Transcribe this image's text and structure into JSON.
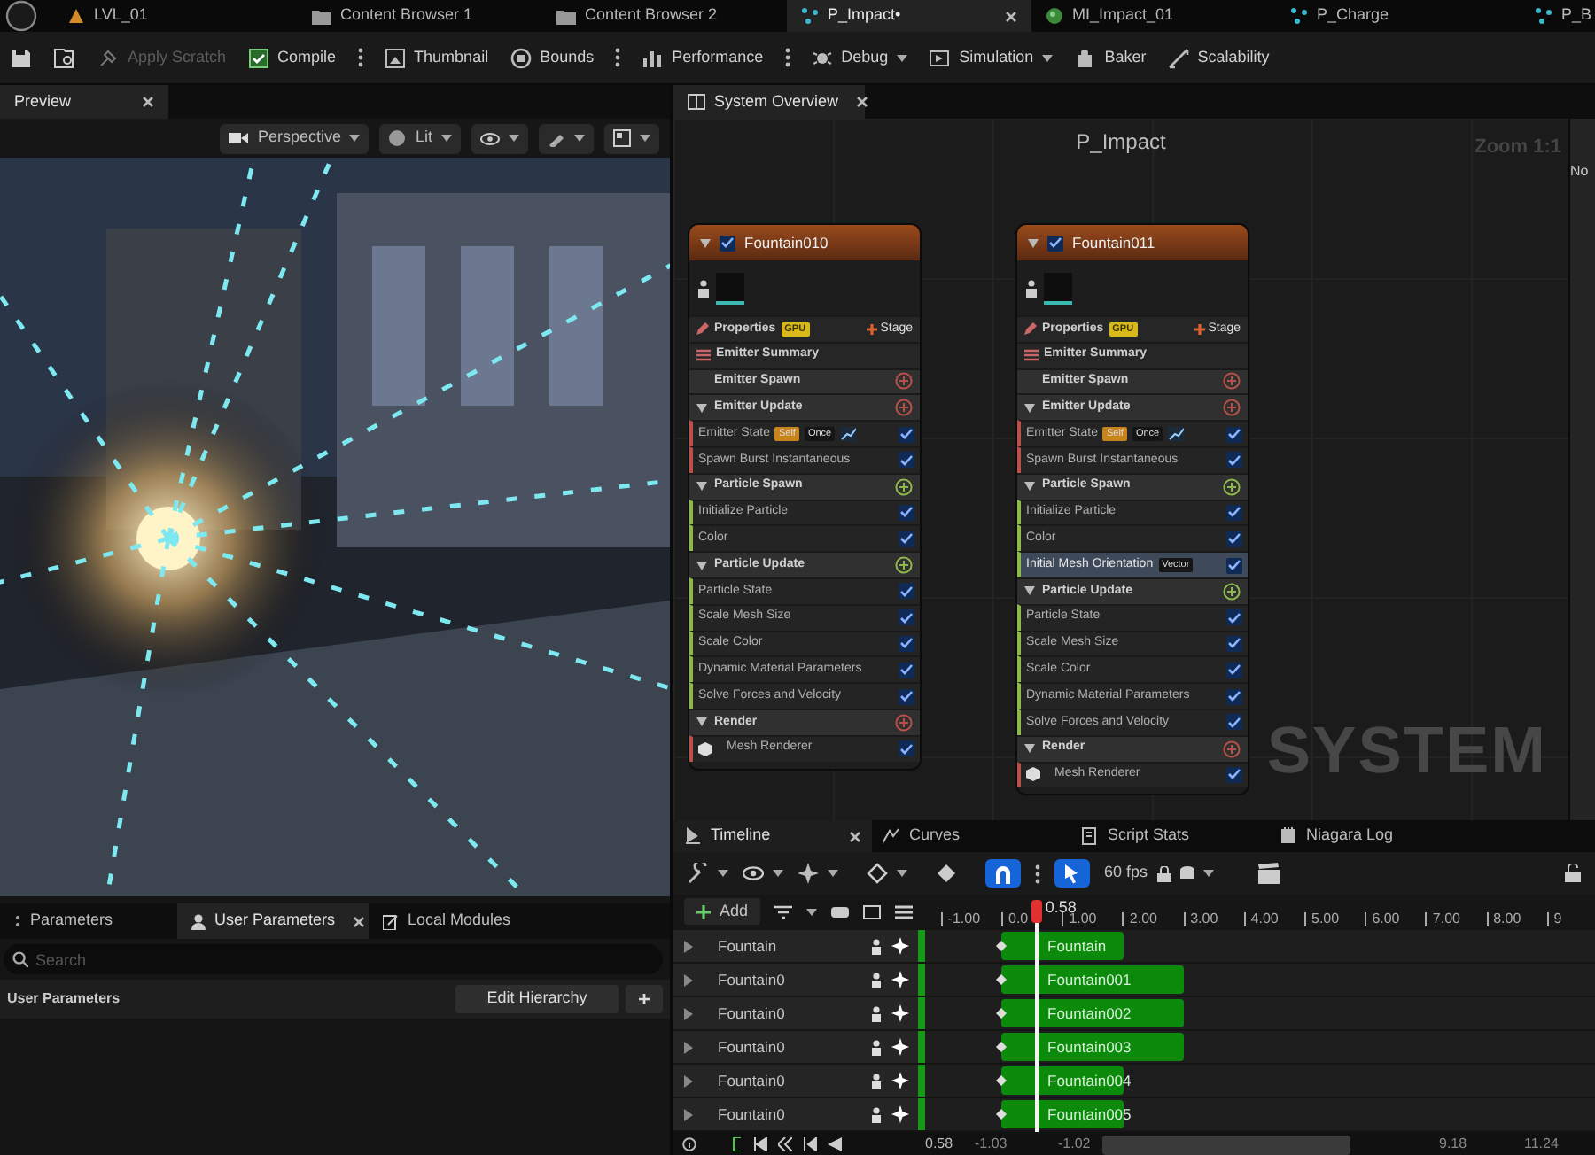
{
  "document_tabs": [
    {
      "label": "LVL_01",
      "selected": false
    },
    {
      "label": "Content Browser 1",
      "selected": false
    },
    {
      "label": "Content Browser 2",
      "selected": false
    },
    {
      "label": "P_Impact•",
      "selected": true
    },
    {
      "label": "MI_Impact_01",
      "selected": false
    },
    {
      "label": "P_Charge",
      "selected": false
    },
    {
      "label": "P_B",
      "selected": false
    }
  ],
  "toolbar": [
    {
      "label": "Apply Scratch",
      "disabled": true,
      "dropdown": false,
      "options": false
    },
    {
      "label": "Compile",
      "disabled": false,
      "dropdown": false,
      "options": true
    },
    {
      "label": "Thumbnail",
      "disabled": false,
      "dropdown": false,
      "options": false
    },
    {
      "label": "Bounds",
      "disabled": false,
      "dropdown": false,
      "options": true
    },
    {
      "label": "Performance",
      "disabled": false,
      "dropdown": false,
      "options": true
    },
    {
      "label": "Debug",
      "disabled": false,
      "dropdown": true,
      "options": false
    },
    {
      "label": "Simulation",
      "disabled": false,
      "dropdown": true,
      "options": false
    },
    {
      "label": "Baker",
      "disabled": false,
      "dropdown": false,
      "options": false
    },
    {
      "label": "Scalability",
      "disabled": false,
      "dropdown": false,
      "options": false
    }
  ],
  "preview": {
    "tab": "Preview",
    "view_mode": "Perspective",
    "lighting": "Lit"
  },
  "parameters": {
    "tabs": [
      {
        "label": "Parameters",
        "selected": false
      },
      {
        "label": "User Parameters",
        "selected": true
      },
      {
        "label": "Local Modules",
        "selected": false
      }
    ],
    "search": {
      "placeholder": "Search"
    },
    "section": "User Parameters",
    "edit_button": "Edit Hierarchy",
    "add_button": "+"
  },
  "system_overview": {
    "tab": "System Overview",
    "title": "P_Impact",
    "zoom": "Zoom 1:1",
    "watermark": "SYSTEM",
    "emitters": [
      {
        "name": "Fountain010",
        "enabled": true,
        "properties": "Properties",
        "badge": "GPU",
        "stage": "Stage",
        "summary": "Emitter Summary",
        "sections": [
          {
            "title": "Emitter Spawn",
            "color": "#b9504a",
            "collapsible": false
          },
          {
            "title": "Emitter Update",
            "color": "#b9504a",
            "collapsible": true,
            "modules": [
              {
                "name": "Emitter State",
                "kind": "state",
                "enabled": true,
                "selected": false,
                "tags": [
                  {
                    "label": "Self",
                    "color": "#c8841c"
                  },
                  {
                    "label": "Once",
                    "color": "#151515"
                  }
                ]
              },
              {
                "name": "Spawn Burst Instantaneous",
                "kind": "module",
                "enabled": true,
                "selected": false
              }
            ]
          },
          {
            "title": "Particle Spawn",
            "color": "#8db84a",
            "collapsible": true,
            "modules": [
              {
                "name": "Initialize Particle",
                "kind": "module",
                "enabled": true,
                "selected": false
              },
              {
                "name": "Color",
                "kind": "module",
                "enabled": true,
                "selected": false
              }
            ]
          },
          {
            "title": "Particle Update",
            "color": "#8db84a",
            "collapsible": true,
            "modules": [
              {
                "name": "Particle State",
                "kind": "module",
                "enabled": true,
                "selected": false
              },
              {
                "name": "Scale Mesh Size",
                "kind": "module",
                "enabled": true,
                "selected": false
              },
              {
                "name": "Scale Color",
                "kind": "module",
                "enabled": true,
                "selected": false
              },
              {
                "name": "Dynamic Material Parameters",
                "kind": "module",
                "enabled": true,
                "selected": false
              },
              {
                "name": "Solve Forces and Velocity",
                "kind": "module",
                "enabled": true,
                "selected": false
              }
            ]
          },
          {
            "title": "Render",
            "color": "#b9504a",
            "collapsible": true,
            "modules": [
              {
                "name": "Mesh Renderer",
                "kind": "renderer",
                "enabled": true,
                "selected": false
              }
            ]
          }
        ]
      },
      {
        "name": "Fountain011",
        "enabled": true,
        "properties": "Properties",
        "badge": "GPU",
        "stage": "Stage",
        "summary": "Emitter Summary",
        "sections": [
          {
            "title": "Emitter Spawn",
            "color": "#b9504a",
            "collapsible": false
          },
          {
            "title": "Emitter Update",
            "color": "#b9504a",
            "collapsible": true,
            "modules": [
              {
                "name": "Emitter State",
                "kind": "state",
                "enabled": true,
                "selected": false,
                "tags": [
                  {
                    "label": "Self",
                    "color": "#c8841c"
                  },
                  {
                    "label": "Once",
                    "color": "#151515"
                  }
                ]
              },
              {
                "name": "Spawn Burst Instantaneous",
                "kind": "module",
                "enabled": true,
                "selected": false
              }
            ]
          },
          {
            "title": "Particle Spawn",
            "color": "#8db84a",
            "collapsible": true,
            "modules": [
              {
                "name": "Initialize Particle",
                "kind": "module",
                "enabled": true,
                "selected": false
              },
              {
                "name": "Color",
                "kind": "module",
                "enabled": true,
                "selected": false
              },
              {
                "name": "Initial Mesh Orientation",
                "kind": "module",
                "enabled": true,
                "selected": true,
                "tags": [
                  {
                    "label": "Vector",
                    "color": "#151515"
                  }
                ]
              }
            ]
          },
          {
            "title": "Particle Update",
            "color": "#8db84a",
            "collapsible": true,
            "modules": [
              {
                "name": "Particle State",
                "kind": "module",
                "enabled": true,
                "selected": false
              },
              {
                "name": "Scale Mesh Size",
                "kind": "module",
                "enabled": true,
                "selected": false
              },
              {
                "name": "Scale Color",
                "kind": "module",
                "enabled": true,
                "selected": false
              },
              {
                "name": "Dynamic Material Parameters",
                "kind": "module",
                "enabled": true,
                "selected": false
              },
              {
                "name": "Solve Forces and Velocity",
                "kind": "module",
                "enabled": true,
                "selected": false
              }
            ]
          },
          {
            "title": "Render",
            "color": "#b9504a",
            "collapsible": true,
            "modules": [
              {
                "name": "Mesh Renderer",
                "kind": "renderer",
                "enabled": true,
                "selected": false
              }
            ]
          }
        ]
      }
    ]
  },
  "details_panel": {
    "label": "No"
  },
  "timeline": {
    "tabs": [
      {
        "label": "Timeline",
        "selected": true
      },
      {
        "label": "Curves",
        "selected": false
      },
      {
        "label": "Script Stats",
        "selected": false
      },
      {
        "label": "Niagara Log",
        "selected": false
      }
    ],
    "fps": "60 fps",
    "snap": true,
    "edit_mode": true,
    "add": "Add",
    "playhead": "0.58",
    "ticks": [
      "-1.00",
      "0.0",
      "1.00",
      "2.00",
      "3.00",
      "4.00",
      "5.00",
      "6.00",
      "7.00",
      "8.00",
      "9"
    ],
    "tracks": [
      {
        "label": "Fountain",
        "bar": "Fountain",
        "level": 0.19
      },
      {
        "label": "Fountain0",
        "bar": "Fountain001",
        "level": 0.285
      },
      {
        "label": "Fountain0",
        "bar": "Fountain002",
        "level": 0.285
      },
      {
        "label": "Fountain0",
        "bar": "Fountain003",
        "level": 0.285
      },
      {
        "label": "Fountain0",
        "bar": "Fountain004",
        "level": 0.19
      },
      {
        "label": "Fountain0",
        "bar": "Fountain005",
        "level": 0.19
      }
    ],
    "current_time": "0.58",
    "range": [
      "-1.03",
      "-1.02",
      "9.18",
      "11.24"
    ]
  }
}
